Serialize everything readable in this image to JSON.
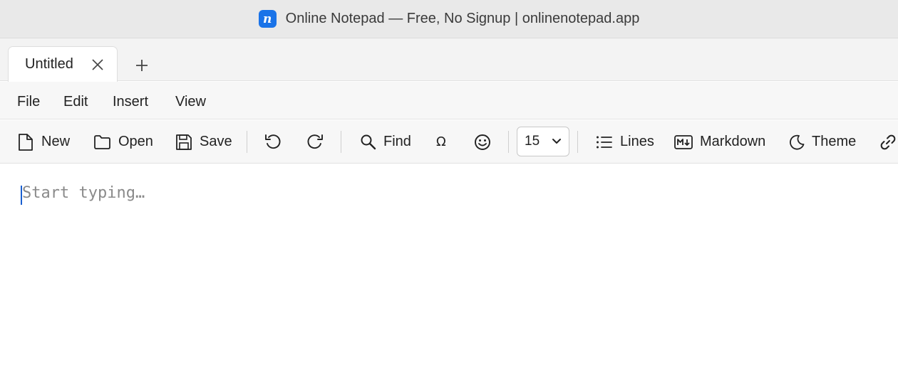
{
  "window": {
    "logo_letter": "n",
    "title": "Online Notepad — Free, No Signup | onlinenotepad.app"
  },
  "tabs": [
    {
      "label": "Untitled"
    }
  ],
  "menu": [
    "File",
    "Edit",
    "Insert",
    "View"
  ],
  "toolbar": {
    "new_label": "New",
    "open_label": "Open",
    "save_label": "Save",
    "find_label": "Find",
    "special_char": "Ω",
    "font_size": "15",
    "lines_label": "Lines",
    "markdown_label": "Markdown",
    "theme_label": "Theme"
  },
  "editor": {
    "placeholder": "Start typing…"
  },
  "colors": {
    "accent": "#1a73e8",
    "caret": "#1a5fd0"
  }
}
